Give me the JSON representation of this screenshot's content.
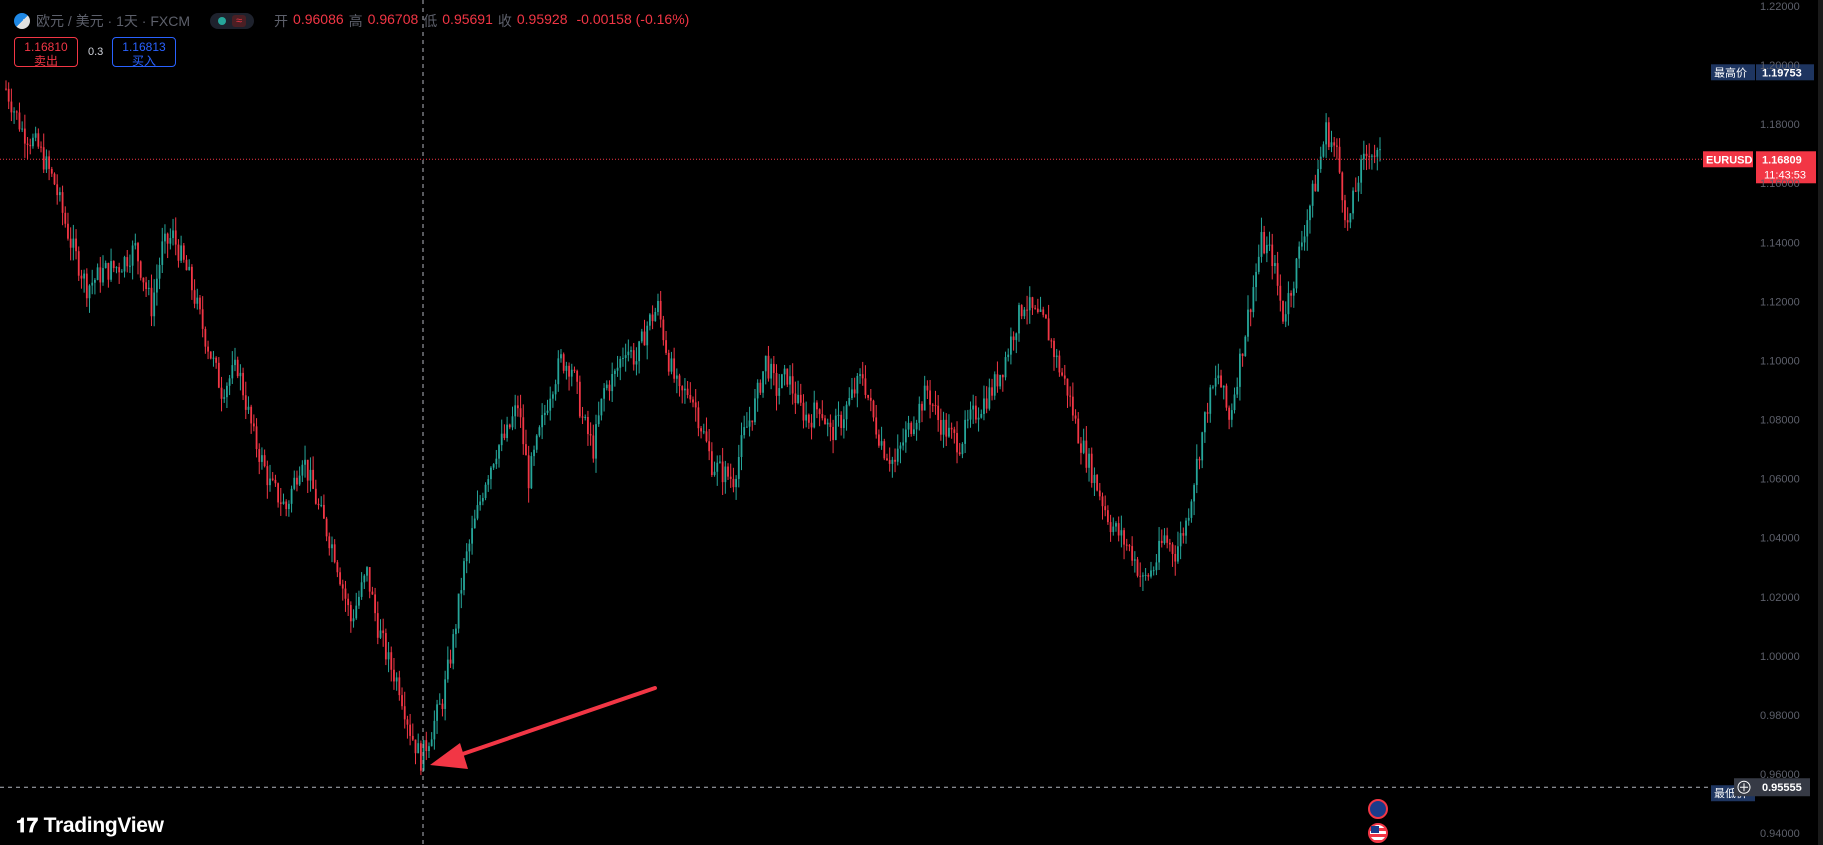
{
  "legend": {
    "title": "欧元 / 美元 · 1天 · FXCM",
    "open_label": "开",
    "open": "0.96086",
    "high_label": "高",
    "high": "0.96708",
    "low_label": "低",
    "low": "0.95691",
    "close_label": "收",
    "close": "0.95928",
    "change": "-0.00158 (-0.16%)"
  },
  "trade": {
    "sell_price": "1.16810",
    "sell_label": "卖出",
    "spread": "0.3",
    "buy_price": "1.16813",
    "buy_label": "买入"
  },
  "brand": "TradingView",
  "colors": {
    "up": "#26a69a",
    "down": "#f23645",
    "background": "#000000",
    "axis_text": "#5d606b",
    "arrow": "#f23645"
  },
  "chart_data": {
    "type": "candlestick",
    "symbol": "EURUSD",
    "interval": "1天",
    "y_ticks": [
      "1.22000",
      "1.20000",
      "1.18000",
      "1.16000",
      "1.14000",
      "1.12000",
      "1.10000",
      "1.08000",
      "1.06000",
      "1.04000",
      "1.02000",
      "1.00000",
      "0.98000",
      "0.96000",
      "0.94000"
    ],
    "ylim": [
      0.936,
      1.222
    ],
    "last_price": {
      "label": "EURUSD",
      "value": "1.16809",
      "countdown": "11:43:53"
    },
    "highest": {
      "label": "最高价",
      "value": "1.19753"
    },
    "lowest": {
      "label": "最低价",
      "value": "0.95555"
    },
    "path": [
      [
        0,
        1.192
      ],
      [
        6,
        1.178
      ],
      [
        12,
        1.172
      ],
      [
        18,
        1.16
      ],
      [
        24,
        1.14
      ],
      [
        30,
        1.125
      ],
      [
        36,
        1.13
      ],
      [
        42,
        1.132
      ],
      [
        48,
        1.138
      ],
      [
        54,
        1.118
      ],
      [
        58,
        1.138
      ],
      [
        62,
        1.142
      ],
      [
        68,
        1.128
      ],
      [
        74,
        1.108
      ],
      [
        80,
        1.09
      ],
      [
        86,
        1.098
      ],
      [
        92,
        1.074
      ],
      [
        98,
        1.058
      ],
      [
        104,
        1.05
      ],
      [
        110,
        1.068
      ],
      [
        116,
        1.05
      ],
      [
        122,
        1.035
      ],
      [
        128,
        1.012
      ],
      [
        134,
        1.028
      ],
      [
        138,
        1.01
      ],
      [
        142,
        0.998
      ],
      [
        146,
        0.99
      ],
      [
        150,
        0.975
      ],
      [
        154,
        0.965
      ],
      [
        158,
        0.975
      ],
      [
        162,
        0.985
      ],
      [
        166,
        1.005
      ],
      [
        170,
        1.03
      ],
      [
        174,
        1.045
      ],
      [
        178,
        1.06
      ],
      [
        182,
        1.07
      ],
      [
        186,
        1.075
      ],
      [
        190,
        1.085
      ],
      [
        194,
        1.06
      ],
      [
        198,
        1.075
      ],
      [
        202,
        1.09
      ],
      [
        206,
        1.1
      ],
      [
        210,
        1.098
      ],
      [
        214,
        1.08
      ],
      [
        218,
        1.07
      ],
      [
        222,
        1.09
      ],
      [
        226,
        1.095
      ],
      [
        230,
        1.105
      ],
      [
        234,
        1.1
      ],
      [
        238,
        1.112
      ],
      [
        242,
        1.118
      ],
      [
        246,
        1.1
      ],
      [
        250,
        1.088
      ],
      [
        254,
        1.09
      ],
      [
        258,
        1.078
      ],
      [
        262,
        1.065
      ],
      [
        266,
        1.062
      ],
      [
        270,
        1.06
      ],
      [
        274,
        1.075
      ],
      [
        278,
        1.085
      ],
      [
        282,
        1.1
      ],
      [
        286,
        1.09
      ],
      [
        290,
        1.095
      ],
      [
        294,
        1.085
      ],
      [
        298,
        1.08
      ],
      [
        302,
        1.085
      ],
      [
        306,
        1.075
      ],
      [
        310,
        1.08
      ],
      [
        314,
        1.088
      ],
      [
        318,
        1.095
      ],
      [
        322,
        1.08
      ],
      [
        326,
        1.07
      ],
      [
        330,
        1.065
      ],
      [
        334,
        1.075
      ],
      [
        338,
        1.082
      ],
      [
        342,
        1.09
      ],
      [
        346,
        1.08
      ],
      [
        350,
        1.075
      ],
      [
        354,
        1.072
      ],
      [
        358,
        1.08
      ],
      [
        362,
        1.085
      ],
      [
        366,
        1.09
      ],
      [
        370,
        1.098
      ],
      [
        374,
        1.11
      ],
      [
        378,
        1.12
      ],
      [
        382,
        1.115
      ],
      [
        386,
        1.112
      ],
      [
        390,
        1.1
      ],
      [
        394,
        1.09
      ],
      [
        398,
        1.075
      ],
      [
        402,
        1.065
      ],
      [
        406,
        1.055
      ],
      [
        410,
        1.045
      ],
      [
        414,
        1.04
      ],
      [
        418,
        1.035
      ],
      [
        422,
        1.025
      ],
      [
        426,
        1.03
      ],
      [
        430,
        1.04
      ],
      [
        434,
        1.035
      ],
      [
        438,
        1.045
      ],
      [
        442,
        1.065
      ],
      [
        446,
        1.085
      ],
      [
        450,
        1.095
      ],
      [
        454,
        1.08
      ],
      [
        458,
        1.1
      ],
      [
        462,
        1.12
      ],
      [
        466,
        1.14
      ],
      [
        470,
        1.135
      ],
      [
        474,
        1.115
      ],
      [
        478,
        1.128
      ],
      [
        482,
        1.145
      ],
      [
        486,
        1.16
      ],
      [
        490,
        1.178
      ],
      [
        494,
        1.17
      ],
      [
        498,
        1.145
      ],
      [
        502,
        1.162
      ],
      [
        506,
        1.172
      ],
      [
        510,
        1.168
      ]
    ],
    "annotation": {
      "type": "arrow",
      "points_to": "lowest"
    }
  }
}
